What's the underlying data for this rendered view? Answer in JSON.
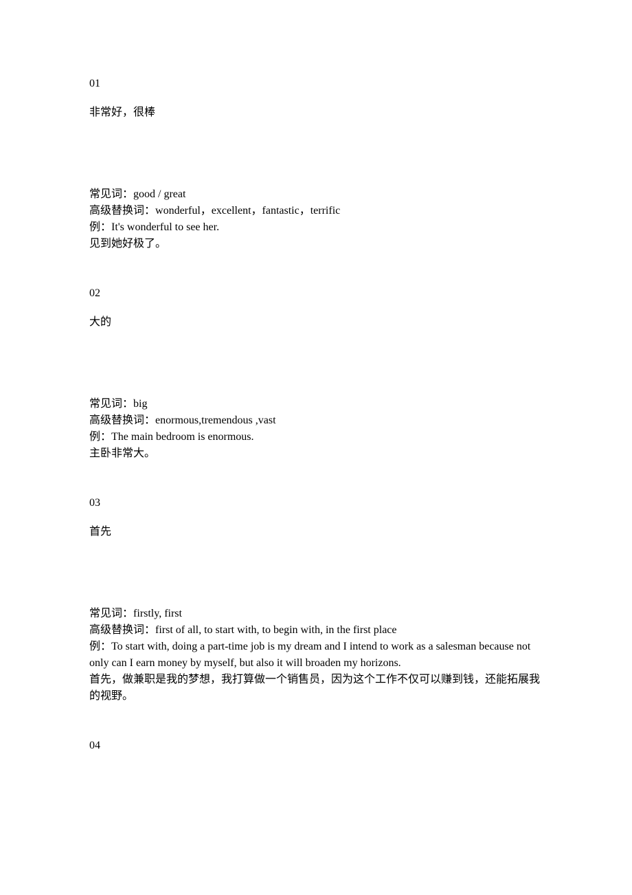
{
  "entries": [
    {
      "number": "01",
      "title": "非常好，很棒",
      "common_label": "常见词：",
      "common_words": "good / great",
      "advanced_label": "高级替换词：",
      "advanced_words": "wonderful，excellent，fantastic，terrific",
      "example_label": "例：",
      "example_en": "It's wonderful to see her.",
      "example_cn": "见到她好极了。"
    },
    {
      "number": "02",
      "title": "大的",
      "common_label": "常见词：",
      "common_words": "big",
      "advanced_label": "高级替换词：",
      "advanced_words": "enormous,tremendous ,vast",
      "example_label": "例：",
      "example_en": "The main bedroom is enormous.",
      "example_cn": "主卧非常大。"
    },
    {
      "number": "03",
      "title": "首先",
      "common_label": "常见词：",
      "common_words": "firstly, first",
      "advanced_label": "高级替换词：",
      "advanced_words": "first of all, to start with, to begin with, in the first place",
      "example_label": "例：",
      "example_en": "To start with, doing a part-time job is my dream and I intend to work as a salesman because not only can I earn money by myself, but also it will broaden my horizons.",
      "example_cn": "首先，做兼职是我的梦想，我打算做一个销售员，因为这个工作不仅可以赚到钱，还能拓展我的视野。"
    }
  ],
  "next_number": "04"
}
